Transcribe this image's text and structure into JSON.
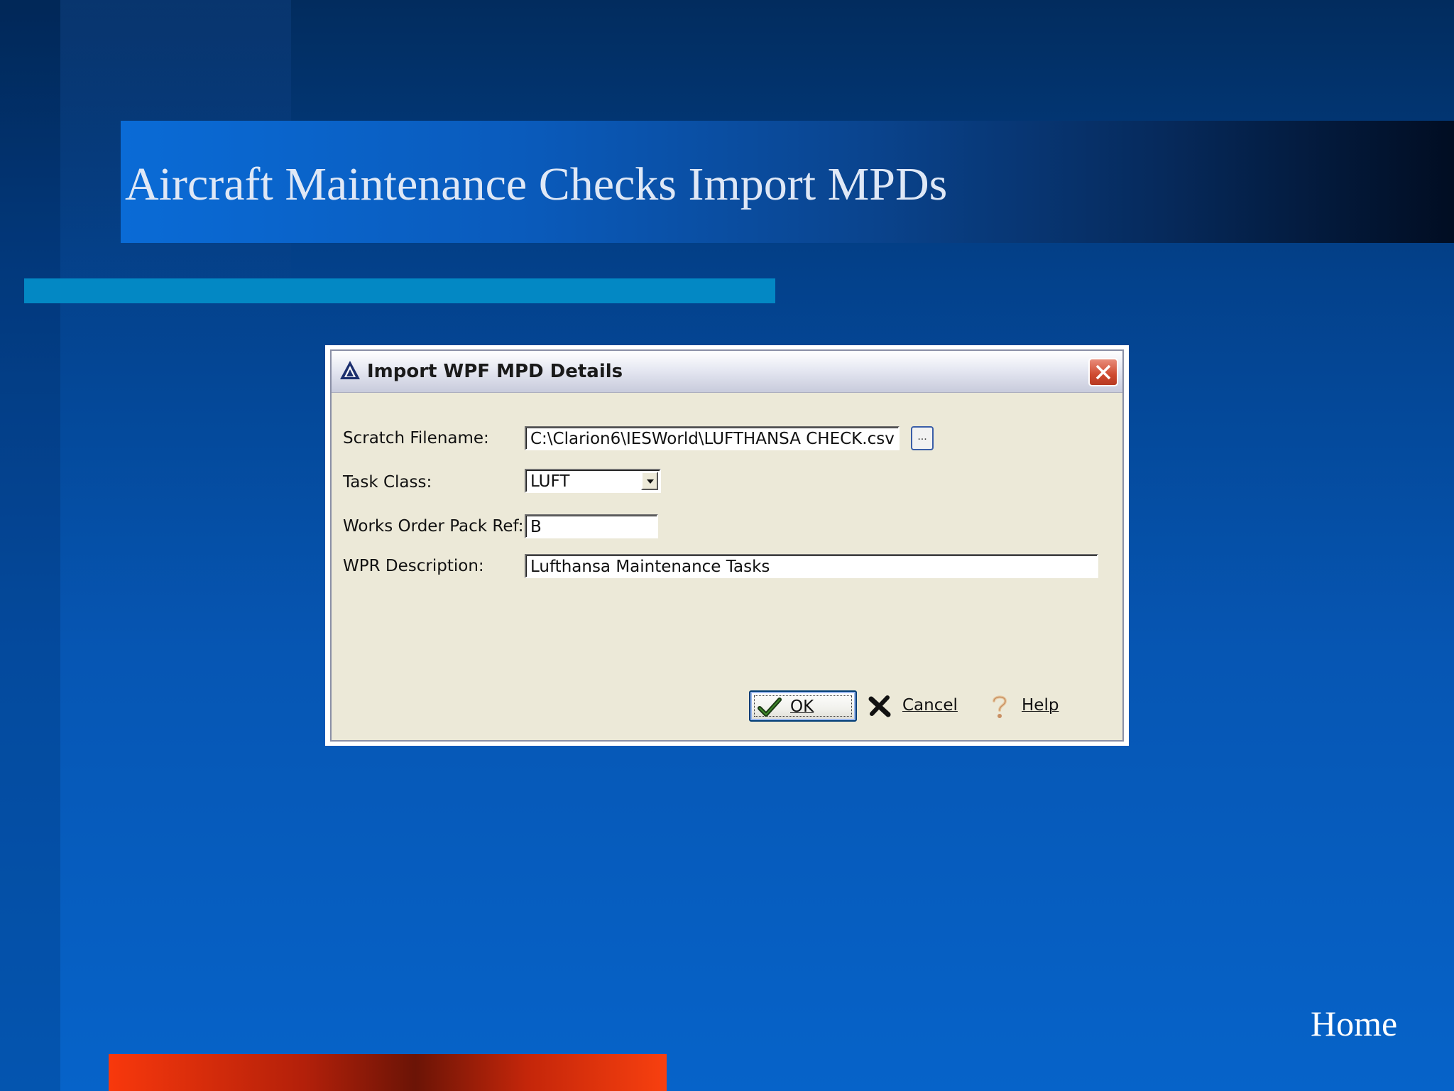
{
  "slide": {
    "title": "Aircraft Maintenance Checks Import MPDs",
    "home_link": "Home"
  },
  "dialog": {
    "title": "Import WPF MPD Details",
    "fields": {
      "scratch_filename": {
        "label": "Scratch Filename:",
        "value": "C:\\Clarion6\\IESWorld\\LUFTHANSA CHECK.csv"
      },
      "task_class": {
        "label": "Task Class:",
        "value": "LUFT"
      },
      "works_order_pack_ref": {
        "label": "Works Order Pack Ref:",
        "value": "B"
      },
      "wpr_description": {
        "label": "WPR Description:",
        "value": "Lufthansa Maintenance Tasks"
      }
    },
    "browse_label": "...",
    "buttons": {
      "ok": "OK",
      "cancel": "Cancel",
      "help": "Help"
    }
  },
  "colors": {
    "accent_bar": "#0388c4",
    "bottom_bar": "#f8380c",
    "dialog_face": "#ece9d8"
  }
}
